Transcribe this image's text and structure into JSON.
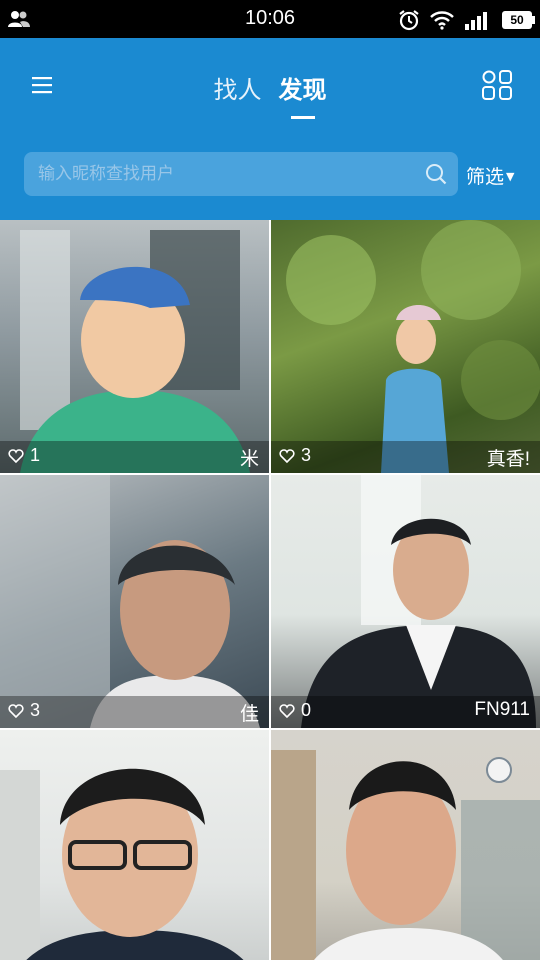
{
  "status_bar": {
    "time": "10:06",
    "battery": "50"
  },
  "header": {
    "tabs": [
      {
        "label": "找人",
        "active": false
      },
      {
        "label": "发现",
        "active": true
      }
    ],
    "menu_icon": "hamburger-menu-icon",
    "grid_icon": "grid-layout-icon"
  },
  "search": {
    "placeholder": "输入昵称查找用户",
    "value": "",
    "filter_label": "筛选"
  },
  "colors": {
    "app_bar": "#1b8ad1",
    "search_field": "#4aa3dd"
  },
  "users": [
    {
      "likes": "1",
      "nickname": "米"
    },
    {
      "likes": "3",
      "nickname": "真香!"
    },
    {
      "likes": "3",
      "nickname": "佳"
    },
    {
      "likes": "0",
      "nickname": "FN911"
    },
    {
      "likes": "",
      "nickname": ""
    },
    {
      "likes": "",
      "nickname": ""
    }
  ]
}
